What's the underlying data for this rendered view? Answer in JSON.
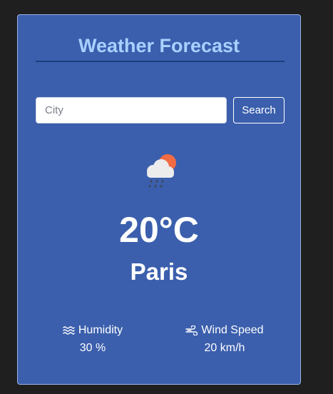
{
  "header": {
    "title": "Weather Forecast"
  },
  "search": {
    "placeholder": "City",
    "value": "",
    "button_label": "Search"
  },
  "current": {
    "icon": "rain-cloud-sun-icon",
    "temperature": "20°C",
    "city": "Paris"
  },
  "stats": {
    "humidity": {
      "icon": "humidity-waves-icon",
      "label": "Humidity",
      "value": "30 %"
    },
    "wind": {
      "icon": "wind-icon",
      "label": "Wind Speed",
      "value": "20 km/h"
    }
  },
  "colors": {
    "page_background": "#1f1f1f",
    "card_background": "#3b5fad",
    "title": "#a9d0ff",
    "title_rule": "#17407e",
    "sun": "#f26b43"
  }
}
